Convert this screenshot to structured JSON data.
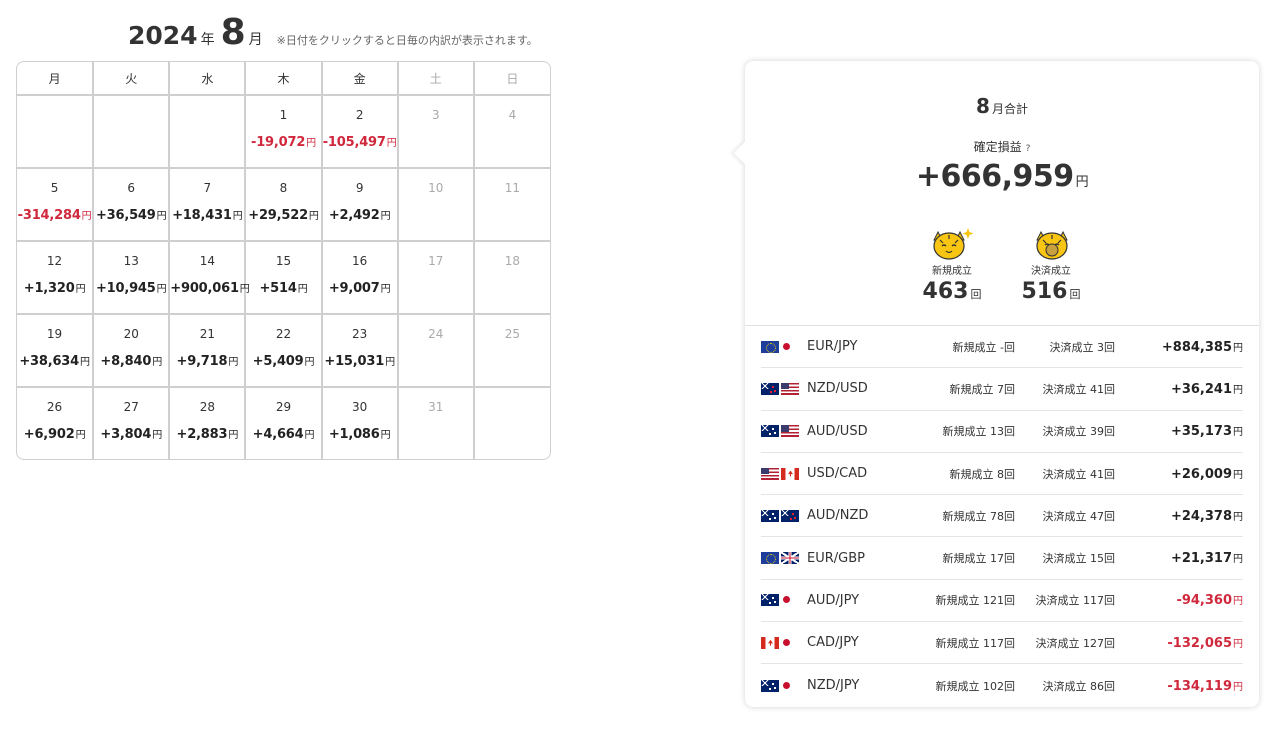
{
  "header": {
    "year": "2024",
    "year_unit": "年",
    "month": "8",
    "month_unit": "月",
    "note": "※日付をクリックすると日毎の内訳が表示されます。"
  },
  "calendar": {
    "weekdays": [
      {
        "label": "月",
        "weekend": false
      },
      {
        "label": "火",
        "weekend": false
      },
      {
        "label": "水",
        "weekend": false
      },
      {
        "label": "木",
        "weekend": false
      },
      {
        "label": "金",
        "weekend": false
      },
      {
        "label": "土",
        "weekend": true
      },
      {
        "label": "日",
        "weekend": true
      }
    ],
    "yen": "円",
    "weeks": [
      [
        null,
        null,
        null,
        {
          "day": "1",
          "pnl": "-19,072",
          "sign": "neg"
        },
        {
          "day": "2",
          "pnl": "-105,497",
          "sign": "neg"
        },
        {
          "day": "3",
          "pnl": "",
          "weekend": true
        },
        {
          "day": "4",
          "pnl": "",
          "weekend": true
        }
      ],
      [
        {
          "day": "5",
          "pnl": "-314,284",
          "sign": "neg"
        },
        {
          "day": "6",
          "pnl": "+36,549",
          "sign": "pos"
        },
        {
          "day": "7",
          "pnl": "+18,431",
          "sign": "pos"
        },
        {
          "day": "8",
          "pnl": "+29,522",
          "sign": "pos"
        },
        {
          "day": "9",
          "pnl": "+2,492",
          "sign": "pos"
        },
        {
          "day": "10",
          "pnl": "",
          "weekend": true
        },
        {
          "day": "11",
          "pnl": "",
          "weekend": true
        }
      ],
      [
        {
          "day": "12",
          "pnl": "+1,320",
          "sign": "pos"
        },
        {
          "day": "13",
          "pnl": "+10,945",
          "sign": "pos"
        },
        {
          "day": "14",
          "pnl": "+900,061",
          "sign": "pos"
        },
        {
          "day": "15",
          "pnl": "+514",
          "sign": "pos"
        },
        {
          "day": "16",
          "pnl": "+9,007",
          "sign": "pos"
        },
        {
          "day": "17",
          "pnl": "",
          "weekend": true
        },
        {
          "day": "18",
          "pnl": "",
          "weekend": true
        }
      ],
      [
        {
          "day": "19",
          "pnl": "+38,634",
          "sign": "pos"
        },
        {
          "day": "20",
          "pnl": "+8,840",
          "sign": "pos"
        },
        {
          "day": "21",
          "pnl": "+9,718",
          "sign": "pos"
        },
        {
          "day": "22",
          "pnl": "+5,409",
          "sign": "pos"
        },
        {
          "day": "23",
          "pnl": "+15,031",
          "sign": "pos"
        },
        {
          "day": "24",
          "pnl": "",
          "weekend": true
        },
        {
          "day": "25",
          "pnl": "",
          "weekend": true
        }
      ],
      [
        {
          "day": "26",
          "pnl": "+6,902",
          "sign": "pos"
        },
        {
          "day": "27",
          "pnl": "+3,804",
          "sign": "pos"
        },
        {
          "day": "28",
          "pnl": "+2,883",
          "sign": "pos"
        },
        {
          "day": "29",
          "pnl": "+4,664",
          "sign": "pos"
        },
        {
          "day": "30",
          "pnl": "+1,086",
          "sign": "pos"
        },
        {
          "day": "31",
          "pnl": "",
          "weekend": true
        },
        null
      ]
    ]
  },
  "summary": {
    "title_num": "8",
    "title_unit": "月合計",
    "profit_label": "確定損益",
    "help_icon": "?",
    "profit_total": "+666,959",
    "yen": "円",
    "new_label": "新規成立",
    "new_value": "463",
    "settle_label": "決済成立",
    "settle_value": "516",
    "count_unit": "回",
    "mascot_new_icon": "tiger-mascot-sparkle-icon",
    "mascot_settle_icon": "tiger-mascot-coin-icon"
  },
  "pairs": [
    {
      "flags": [
        "eu",
        "jp-mini"
      ],
      "name": "EUR/JPY",
      "new": "新規成立 -回",
      "settle": "決済成立 3回",
      "pnl": "+884,385",
      "sign": "pos"
    },
    {
      "flags": [
        "nz",
        "us"
      ],
      "name": "NZD/USD",
      "new": "新規成立 7回",
      "settle": "決済成立 41回",
      "pnl": "+36,241",
      "sign": "pos"
    },
    {
      "flags": [
        "au",
        "us"
      ],
      "name": "AUD/USD",
      "new": "新規成立 13回",
      "settle": "決済成立 39回",
      "pnl": "+35,173",
      "sign": "pos"
    },
    {
      "flags": [
        "us",
        "ca"
      ],
      "name": "USD/CAD",
      "new": "新規成立 8回",
      "settle": "決済成立 41回",
      "pnl": "+26,009",
      "sign": "pos"
    },
    {
      "flags": [
        "au",
        "nz"
      ],
      "name": "AUD/NZD",
      "new": "新規成立 78回",
      "settle": "決済成立 47回",
      "pnl": "+24,378",
      "sign": "pos"
    },
    {
      "flags": [
        "eu",
        "gb"
      ],
      "name": "EUR/GBP",
      "new": "新規成立 17回",
      "settle": "決済成立 15回",
      "pnl": "+21,317",
      "sign": "pos"
    },
    {
      "flags": [
        "au",
        "jp-mini"
      ],
      "name": "AUD/JPY",
      "new": "新規成立 121回",
      "settle": "決済成立 117回",
      "pnl": "-94,360",
      "sign": "neg"
    },
    {
      "flags": [
        "ca",
        "jp-mini"
      ],
      "name": "CAD/JPY",
      "new": "新規成立 117回",
      "settle": "決済成立 127回",
      "pnl": "-132,065",
      "sign": "neg"
    },
    {
      "flags": [
        "au",
        "jp-mini"
      ],
      "name": "NZD/JPY",
      "new": "新規成立 102回",
      "settle": "決済成立 86回",
      "pnl": "-134,119",
      "sign": "neg"
    }
  ],
  "colors": {
    "negative": "#d0283c",
    "positive": "#222222",
    "border": "#cfcfcf",
    "mascot_yellow": "#f7c512"
  }
}
